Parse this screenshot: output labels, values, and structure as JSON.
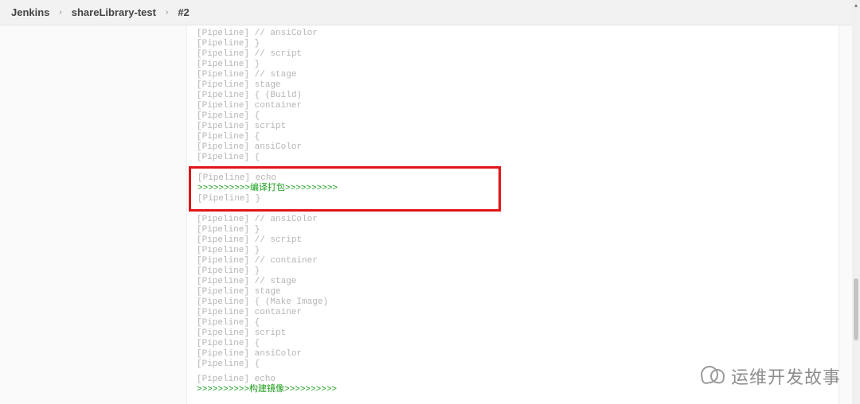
{
  "breadcrumb": {
    "items": [
      "Jenkins",
      "shareLibrary-test",
      "#2"
    ],
    "sep": "›"
  },
  "console": {
    "block_pre": [
      "[Pipeline] // ansiColor",
      "[Pipeline] }",
      "[Pipeline] // script",
      "[Pipeline] }",
      "[Pipeline] // stage",
      "[Pipeline] stage",
      "[Pipeline] { (Build)",
      "[Pipeline] container",
      "[Pipeline] {",
      "[Pipeline] script",
      "[Pipeline] {",
      "[Pipeline] ansiColor",
      "[Pipeline] {"
    ],
    "highlight": {
      "line1": "[Pipeline] echo",
      "line2": ">>>>>>>>>>编译打包>>>>>>>>>>",
      "line3": "[Pipeline] }"
    },
    "block_mid": [
      "[Pipeline] // ansiColor",
      "[Pipeline] }",
      "[Pipeline] // script",
      "[Pipeline] }",
      "[Pipeline] // container",
      "[Pipeline] }",
      "[Pipeline] // stage",
      "[Pipeline] stage",
      "[Pipeline] { (Make Image)",
      "[Pipeline] container",
      "[Pipeline] {",
      "[Pipeline] script",
      "[Pipeline] {",
      "[Pipeline] ansiColor",
      "[Pipeline] {"
    ],
    "block_end_pre": "[Pipeline] echo",
    "block_end_green": ">>>>>>>>>>构建镜像>>>>>>>>>>"
  },
  "watermark": {
    "text": "运维开发故事"
  }
}
